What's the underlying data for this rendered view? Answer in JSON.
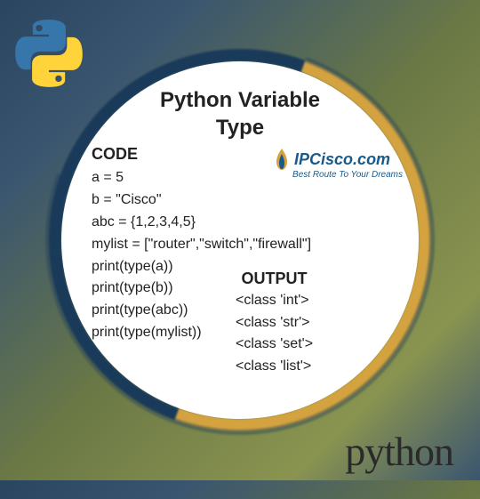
{
  "title_line1": "Python Variable",
  "title_line2": "Type",
  "code_heading": "CODE",
  "code_lines": [
    "a = 5",
    "b = \"Cisco\"",
    "abc = {1,2,3,4,5}",
    "mylist = [\"router\",\"switch\",\"firewall\"]",
    "print(type(a))",
    "print(type(b))",
    "print(type(abc))",
    "print(type(mylist))"
  ],
  "output_heading": "OUTPUT",
  "output_lines": [
    "<class 'int'>",
    "<class 'str'>",
    "<class 'set'>",
    "<class 'list'>"
  ],
  "brand": {
    "name": "IPCisco.com",
    "tagline": "Best Route To Your Dreams"
  },
  "footer_logo": "python"
}
